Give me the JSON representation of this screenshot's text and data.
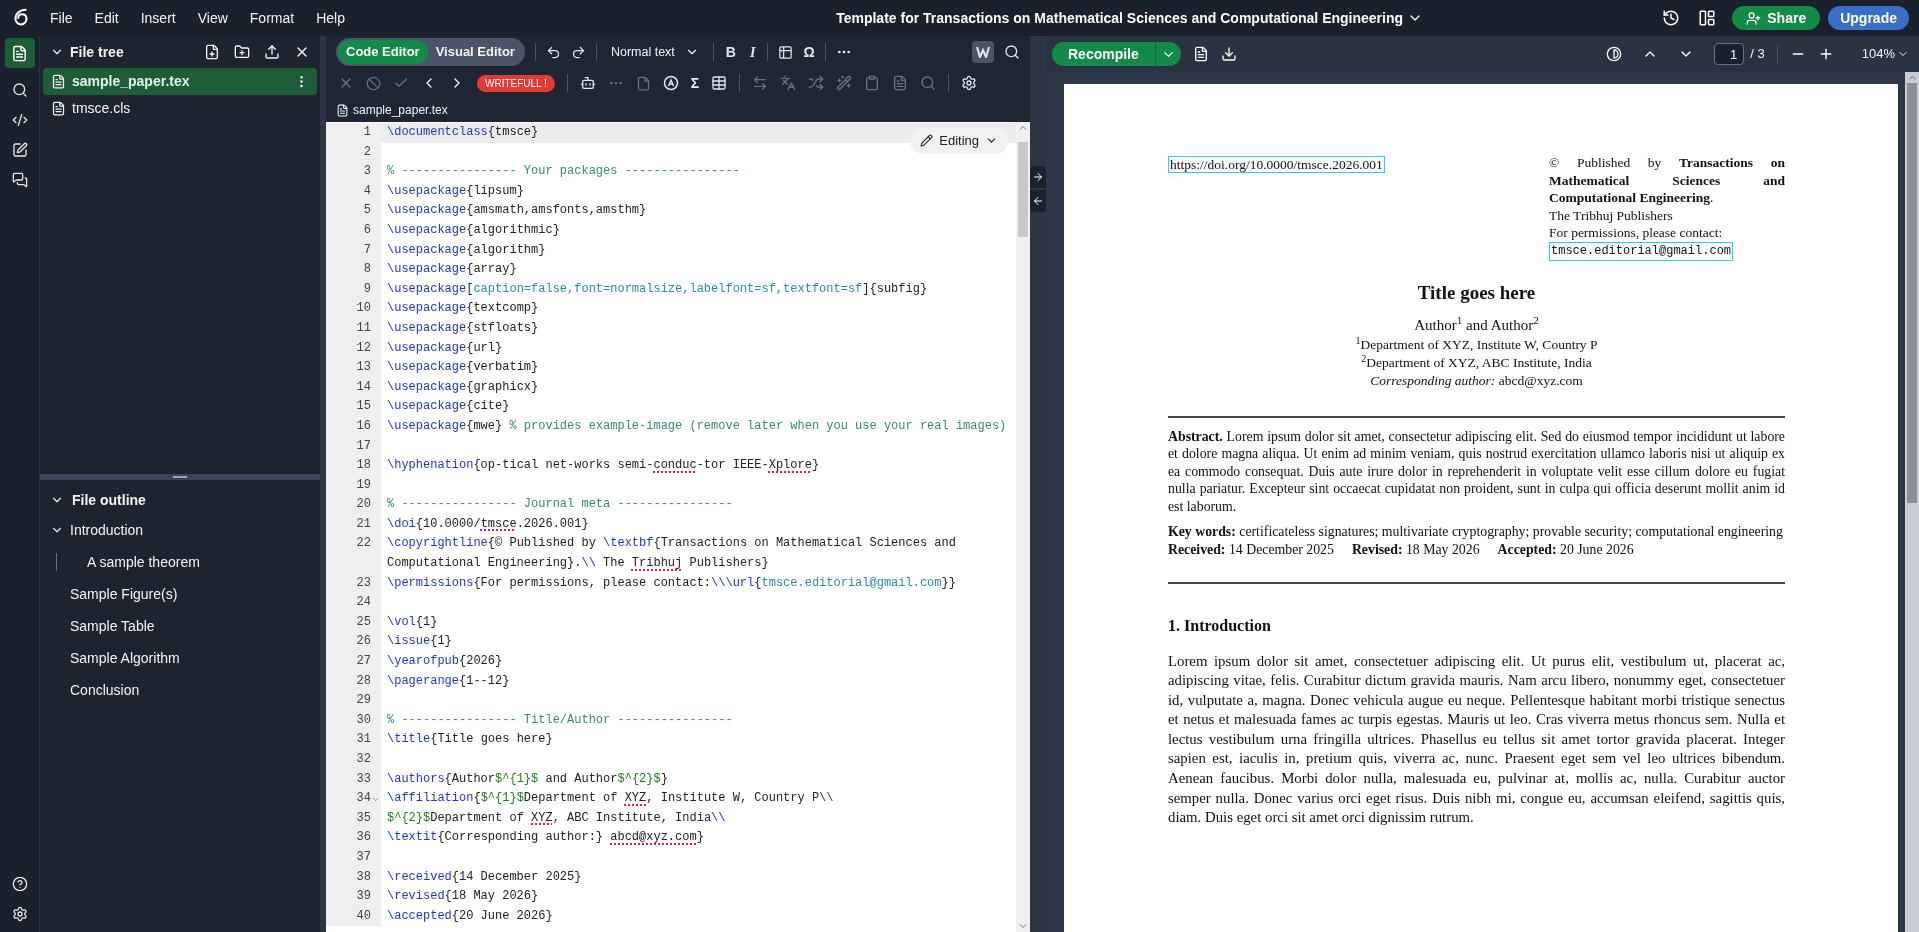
{
  "menu": [
    "File",
    "Edit",
    "Insert",
    "View",
    "Format",
    "Help"
  ],
  "title": "Template for Transactions on Mathematical Sciences and Computational Engineering",
  "header_buttons": {
    "share": "Share",
    "upgrade": "Upgrade"
  },
  "file_tree": {
    "title": "File tree",
    "files": [
      {
        "name": "sample_paper.tex",
        "selected": true
      },
      {
        "name": "tmsce.cls",
        "selected": false
      }
    ]
  },
  "file_outline": {
    "title": "File outline",
    "items": [
      {
        "label": "Introduction",
        "expanded": true,
        "children": [
          {
            "label": "A sample theorem"
          }
        ]
      },
      {
        "label": "Sample Figure(s)"
      },
      {
        "label": "Sample Table"
      },
      {
        "label": "Sample Algorithm"
      },
      {
        "label": "Conclusion"
      }
    ]
  },
  "editor": {
    "modes": [
      {
        "label": "Code Editor",
        "selected": true
      },
      {
        "label": "Visual Editor",
        "selected": false
      }
    ],
    "style_select": "Normal text",
    "bold": "B",
    "italic": "I",
    "symbol": "Ω",
    "review_badge": "WRITEFULL !",
    "math": "Σ",
    "tab": "sample_paper.tex",
    "editing_menu": "Editing",
    "lines": [
      {
        "n": "1",
        "foldable": false,
        "tokens": [
          {
            "kind": "cmd",
            "t": "\\documentclass"
          },
          {
            "kind": "text",
            "t": "{tmsce}"
          }
        ]
      },
      {
        "n": "2",
        "foldable": false
      },
      {
        "n": "3",
        "foldable": false,
        "tokens": [
          {
            "kind": "comment",
            "t": "% ---------------- Your packages ----------------"
          }
        ]
      },
      {
        "n": "4",
        "foldable": false,
        "tokens": [
          {
            "kind": "cmd",
            "t": "\\usepackage"
          },
          {
            "kind": "text",
            "t": "{lipsum}"
          }
        ]
      },
      {
        "n": "5",
        "foldable": false,
        "tokens": [
          {
            "kind": "cmd",
            "t": "\\usepackage"
          },
          {
            "kind": "text",
            "t": "{amsmath,amsfonts,amsthm}"
          }
        ]
      },
      {
        "n": "6",
        "foldable": false,
        "tokens": [
          {
            "kind": "cmd",
            "t": "\\usepackage"
          },
          {
            "kind": "text",
            "t": "{algorithmic}"
          }
        ]
      },
      {
        "n": "7",
        "foldable": false,
        "tokens": [
          {
            "kind": "cmd",
            "t": "\\usepackage"
          },
          {
            "kind": "text",
            "t": "{algorithm}"
          }
        ]
      },
      {
        "n": "8",
        "foldable": false,
        "tokens": [
          {
            "kind": "cmd",
            "t": "\\usepackage"
          },
          {
            "kind": "text",
            "t": "{array}"
          }
        ]
      },
      {
        "n": "9",
        "foldable": false,
        "tokens": [
          {
            "kind": "cmd",
            "t": "\\usepackage"
          },
          {
            "kind": "text",
            "t": "["
          },
          {
            "kind": "arg",
            "t": "caption=false,font=normalsize,labelfont=sf,textfont=sf"
          },
          {
            "kind": "text",
            "t": "]{subfig}"
          }
        ]
      },
      {
        "n": "10",
        "foldable": false,
        "tokens": [
          {
            "kind": "cmd",
            "t": "\\usepackage"
          },
          {
            "kind": "text",
            "t": "{textcomp}"
          }
        ]
      },
      {
        "n": "11",
        "foldable": false,
        "tokens": [
          {
            "kind": "cmd",
            "t": "\\usepackage"
          },
          {
            "kind": "text",
            "t": "{stfloats}"
          }
        ]
      },
      {
        "n": "12",
        "foldable": false,
        "tokens": [
          {
            "kind": "cmd",
            "t": "\\usepackage"
          },
          {
            "kind": "text",
            "t": "{url}"
          }
        ]
      },
      {
        "n": "13",
        "foldable": false,
        "tokens": [
          {
            "kind": "cmd",
            "t": "\\usepackage"
          },
          {
            "kind": "text",
            "t": "{verbatim}"
          }
        ]
      },
      {
        "n": "14",
        "foldable": false,
        "tokens": [
          {
            "kind": "cmd",
            "t": "\\usepackage"
          },
          {
            "kind": "text",
            "t": "{graphicx}"
          }
        ]
      },
      {
        "n": "15",
        "foldable": false,
        "tokens": [
          {
            "kind": "cmd",
            "t": "\\usepackage"
          },
          {
            "kind": "text",
            "t": "{cite}"
          }
        ]
      },
      {
        "n": "16",
        "foldable": false,
        "tokens": [
          {
            "kind": "cmd",
            "t": "\\usepackage"
          },
          {
            "kind": "text",
            "t": "{mwe} "
          },
          {
            "kind": "comment",
            "t": "% provides example-image (remove later when you use your real images)"
          }
        ]
      },
      {
        "n": "17",
        "foldable": false
      },
      {
        "n": "18",
        "foldable": false,
        "tokens": [
          {
            "kind": "cmd",
            "t": "\\hyphenation"
          },
          {
            "kind": "text",
            "t": "{op-tical net-works semi-"
          },
          {
            "kind": "misspelled",
            "t": "conduc"
          },
          {
            "kind": "text",
            "t": "-tor IEEE-"
          },
          {
            "kind": "misspelled",
            "t": "Xplore"
          },
          {
            "kind": "text",
            "t": "}"
          }
        ]
      },
      {
        "n": "19",
        "foldable": false
      },
      {
        "n": "20",
        "foldable": false,
        "tokens": [
          {
            "kind": "comment",
            "t": "% ---------------- Journal meta ----------------"
          }
        ]
      },
      {
        "n": "21",
        "foldable": false,
        "tokens": [
          {
            "kind": "cmd",
            "t": "\\doi"
          },
          {
            "kind": "text",
            "t": "{10.0000/"
          },
          {
            "kind": "misspelled",
            "t": "tmsce"
          },
          {
            "kind": "text",
            "t": ".2026.001}"
          }
        ]
      },
      {
        "n": "22",
        "foldable": false,
        "tokens": [
          {
            "kind": "cmd",
            "t": "\\copyrightline"
          },
          {
            "kind": "text",
            "t": "{© Published by "
          },
          {
            "kind": "cmd",
            "t": "\\textbf"
          },
          {
            "kind": "text",
            "t": "{Transactions on Mathematical Sciences and Computational Engineering}."
          },
          {
            "kind": "cmd",
            "t": "\\\\"
          },
          {
            "kind": "text",
            "t": " The "
          },
          {
            "kind": "misspelled",
            "t": "Tribhuj"
          },
          {
            "kind": "text",
            "t": " Publishers}"
          }
        ]
      },
      {
        "n": "23",
        "foldable": false,
        "tokens": [
          {
            "kind": "cmd",
            "t": "\\permissions"
          },
          {
            "kind": "text",
            "t": "{For permissions, please contact:"
          },
          {
            "kind": "cmd",
            "t": "\\\\"
          },
          {
            "kind": "cmd",
            "t": "\\url"
          },
          {
            "kind": "text",
            "t": "{"
          },
          {
            "kind": "arg",
            "t": "tmsce.editorial@gmail.com"
          },
          {
            "kind": "text",
            "t": "}}"
          }
        ]
      },
      {
        "n": "24",
        "foldable": false
      },
      {
        "n": "25",
        "foldable": false,
        "tokens": [
          {
            "kind": "cmd",
            "t": "\\vol"
          },
          {
            "kind": "text",
            "t": "{1}"
          }
        ]
      },
      {
        "n": "26",
        "foldable": false,
        "tokens": [
          {
            "kind": "cmd",
            "t": "\\issue"
          },
          {
            "kind": "text",
            "t": "{1}"
          }
        ]
      },
      {
        "n": "27",
        "foldable": false,
        "tokens": [
          {
            "kind": "cmd",
            "t": "\\yearofpub"
          },
          {
            "kind": "text",
            "t": "{2026}"
          }
        ]
      },
      {
        "n": "28",
        "foldable": false,
        "tokens": [
          {
            "kind": "cmd",
            "t": "\\pagerange"
          },
          {
            "kind": "text",
            "t": "{1--12}"
          }
        ]
      },
      {
        "n": "29",
        "foldable": false
      },
      {
        "n": "30",
        "foldable": false,
        "tokens": [
          {
            "kind": "comment",
            "t": "% ---------------- Title/Author ----------------"
          }
        ]
      },
      {
        "n": "31",
        "foldable": false,
        "tokens": [
          {
            "kind": "cmd",
            "t": "\\title"
          },
          {
            "kind": "text",
            "t": "{Title goes here}"
          }
        ]
      },
      {
        "n": "32",
        "foldable": false
      },
      {
        "n": "33",
        "foldable": false,
        "tokens": [
          {
            "kind": "cmd",
            "t": "\\authors"
          },
          {
            "kind": "text",
            "t": "{Author"
          },
          {
            "kind": "math",
            "t": "$^"
          },
          {
            "kind": "math",
            "t": "{1}$"
          },
          {
            "kind": "text",
            "t": " and Author"
          },
          {
            "kind": "math",
            "t": "$^"
          },
          {
            "kind": "math",
            "t": "{2}$"
          },
          {
            "kind": "text",
            "t": "}"
          }
        ]
      },
      {
        "n": "34",
        "foldable": true,
        "tokens": [
          {
            "kind": "cmd",
            "t": "\\affiliation"
          },
          {
            "kind": "text",
            "t": "{"
          },
          {
            "kind": "math",
            "t": "$^"
          },
          {
            "kind": "math",
            "t": "{1}$"
          },
          {
            "kind": "text",
            "t": "Department of "
          },
          {
            "kind": "misspelled",
            "t": "XYZ"
          },
          {
            "kind": "text",
            "t": ", Institute W, Country P"
          },
          {
            "kind": "cmd",
            "t": "\\\\"
          }
        ]
      },
      {
        "n": "35",
        "foldable": false,
        "tokens": [
          {
            "kind": "math",
            "t": "$^"
          },
          {
            "kind": "math",
            "t": "{2}$"
          },
          {
            "kind": "text",
            "t": "Department of "
          },
          {
            "kind": "misspelled",
            "t": "XYZ"
          },
          {
            "kind": "text",
            "t": ", ABC Institute, India"
          },
          {
            "kind": "cmd",
            "t": "\\\\"
          }
        ]
      },
      {
        "n": "36",
        "foldable": false,
        "tokens": [
          {
            "kind": "cmd",
            "t": "\\textit"
          },
          {
            "kind": "text",
            "t": "{Corresponding author:} "
          },
          {
            "kind": "misspelled",
            "t": "abcd@xyz.com"
          },
          {
            "kind": "text",
            "t": "}"
          }
        ]
      },
      {
        "n": "37",
        "foldable": false
      },
      {
        "n": "38",
        "foldable": false,
        "tokens": [
          {
            "kind": "cmd",
            "t": "\\received"
          },
          {
            "kind": "text",
            "t": "{14 December 2025}"
          }
        ]
      },
      {
        "n": "39",
        "foldable": false,
        "tokens": [
          {
            "kind": "cmd",
            "t": "\\revised"
          },
          {
            "kind": "text",
            "t": "{18 May 2026}"
          }
        ]
      },
      {
        "n": "40",
        "foldable": false,
        "tokens": [
          {
            "kind": "cmd",
            "t": "\\accepted"
          },
          {
            "kind": "text",
            "t": "{20 June 2026}"
          }
        ]
      }
    ]
  },
  "pdf": {
    "recompile": "Recompile",
    "page": "1",
    "page_total": "/ 3",
    "zoom": "104%",
    "doi": "https://doi.org/10.0000/tmsce.2026.001",
    "copyright": "© Published by **Transactions on Mathematical Sciences and Computational Engineering**.",
    "publisher": "The Tribhuj Publishers",
    "permissions": "For permissions, please contact:",
    "email": "tmsce.editorial@gmail.com",
    "paper_title": "Title goes here",
    "authors": "Author$^{1}$ and Author$^{2}$",
    "affiliations": [
      "$^{1}$Department of XYZ, Institute W, Country P",
      "$^{2}$Department of XYZ, ABC Institute, India",
      "*Corresponding author:* abcd@xyz.com"
    ],
    "abstract": "**Abstract.** Lorem ipsum dolor sit amet, consectetur adipiscing elit. Sed do eiusmod tempor incididunt ut labore et dolore magna aliqua. Ut enim ad minim veniam, quis nostrud exercitation ullamco laboris nisi ut aliquip ex ea commodo consequat. Duis aute irure dolor in reprehenderit in voluptate velit esse cillum dolore eu fugiat nulla pariatur. Excepteur sint occaecat cupidatat non proident, sunt in culpa qui officia deserunt mollit anim id est laborum.",
    "keywords": "**Key words:** certificateless signatures; multivariate cryptography; provable security; computational engineering",
    "dates": [
      {
        "label": "Received:",
        "value": "14 December 2025"
      },
      {
        "label": "Revised:",
        "value": "18 May 2026"
      },
      {
        "label": "Accepted:",
        "value": "20 June 2026"
      }
    ],
    "section": "1. Introduction",
    "paragraph": "Lorem ipsum dolor sit amet, consectetuer adipiscing elit. Ut purus elit, vestibulum ut, placerat ac, adipiscing vitae, felis. Curabitur dictum gravida mauris. Nam arcu libero, nonummy eget, consectetuer id, vulputate a, magna. Donec vehicula augue eu neque. Pellentesque habitant morbi tristique senectus et netus et malesuada fames ac turpis egestas. Mauris ut leo. Cras viverra metus rhoncus sem. Nulla et lectus vestibulum urna fringilla ultrices. Phasellus eu tellus sit amet tortor gravida placerat. Integer sapien est, iaculis in, pretium quis, viverra ac, nunc. Praesent eget sem vel leo ultrices bibendum. Aenean faucibus. Morbi dolor nulla, malesuada eu, pulvinar at, mollis ac, nulla. Curabitur auctor semper nulla. Donec varius orci eget risus. Duis nibh mi, congue eu, accumsan eleifend, sagittis quis, diam. Duis eget orci sit amet orci dignissim rutrum."
  }
}
